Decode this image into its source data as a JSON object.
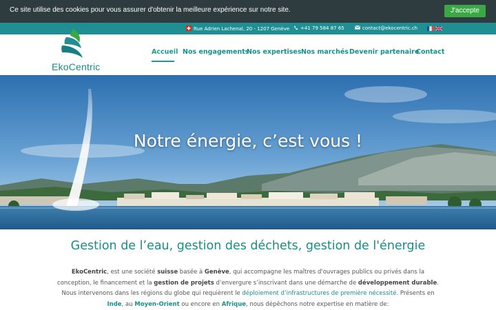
{
  "cookie": {
    "text": "Ce site utilise des cookies pour vous assurer d'obtenir la meilleure expérience sur notre site.",
    "accept": "J'accepte"
  },
  "infobar": {
    "address": "Rue Adrien Lachenal, 20 - 1207 Genève",
    "phone": "+41 79 584 87 65",
    "email": "contact@ekocentric.ch"
  },
  "logo": {
    "name": "EkoCentric"
  },
  "nav": {
    "items": [
      "Accueil",
      "Nos engagements",
      "Nos expertises",
      "Nos marchés",
      "Devenir partenaire",
      "Contact"
    ],
    "active": "Accueil"
  },
  "hero": {
    "title": "Notre énergie, c’est vous !"
  },
  "main": {
    "heading": "Gestion de l’eau, gestion des déchets, gestion de l'énergie",
    "p": {
      "s1": "EkoCentric",
      "s2": ", est une société ",
      "s3": "suisse",
      "s4": " basée à ",
      "s5": "Genève",
      "s6": ", qui accompagne les maîtres d'ouvrages publics ou privés dans la conception, le financement et la ",
      "s7": "gestion de projets",
      "s8": " d’envergure s’inscrivant dans une démarche de ",
      "s9": "développement durable",
      "s10": ". Nous intervenons dans les régions du globe qui requièrent le ",
      "s11": "déploiement d’infrastructures de première nécessité",
      "s12": ". Présents en ",
      "s13": "Inde",
      "s14": ", au ",
      "s15": "Moyen-Orient",
      "s16": " ou encore en ",
      "s17": "Afrique",
      "s18": ", nous dépêchons notre expertise en matière de:"
    }
  },
  "colors": {
    "brand": "#168e8c",
    "infobar": "#1f8f93",
    "cookie_bg": "#2e3b3f",
    "accept": "#3aa845"
  }
}
